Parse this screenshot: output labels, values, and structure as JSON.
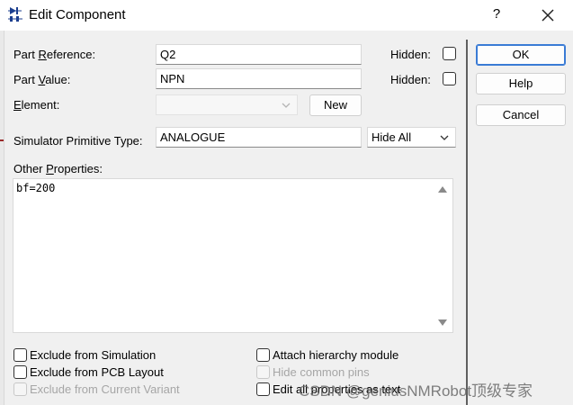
{
  "window": {
    "title": "Edit Component",
    "help_glyph": "?"
  },
  "fields": {
    "part_reference": {
      "label_pre": "Part ",
      "label_ul": "R",
      "label_post": "eference:",
      "value": "Q2"
    },
    "part_value": {
      "label_pre": "Part ",
      "label_ul": "V",
      "label_post": "alue:",
      "value": "NPN"
    },
    "element": {
      "label_pre": "",
      "label_ul": "E",
      "label_post": "lement:",
      "value": ""
    },
    "simulator_primitive_type": {
      "label": "Simulator Primitive Type:",
      "value": "ANALOGUE"
    },
    "other_properties": {
      "label_pre": "Other ",
      "label_ul": "P",
      "label_post": "roperties:",
      "value": "bf=200"
    }
  },
  "hidden": {
    "label": "Hidden:",
    "part_reference_checked": false,
    "part_value_checked": false
  },
  "hide_all_select": {
    "value": "Hide All"
  },
  "buttons": {
    "new": "New",
    "ok": "OK",
    "help": "Help",
    "cancel": "Cancel"
  },
  "options": {
    "exclude_simulation": {
      "label": "Exclude from Simulation",
      "checked": false,
      "enabled": true
    },
    "exclude_pcb": {
      "label": "Exclude from PCB Layout",
      "checked": false,
      "enabled": true
    },
    "exclude_variant": {
      "label": "Exclude from Current Variant",
      "checked": false,
      "enabled": false
    },
    "attach_hierarchy": {
      "label": "Attach hierarchy module",
      "checked": false,
      "enabled": true
    },
    "hide_common_pins": {
      "label": "Hide common pins",
      "checked": false,
      "enabled": false
    },
    "edit_all_properties": {
      "label": "Edit all properties as text",
      "checked": false,
      "enabled": true
    }
  },
  "watermark": "CSDN @geniusNMRobot顶级专家",
  "colors": {
    "default_button_border": "#3a7bd5",
    "disabled_text": "#a6a6a6"
  }
}
